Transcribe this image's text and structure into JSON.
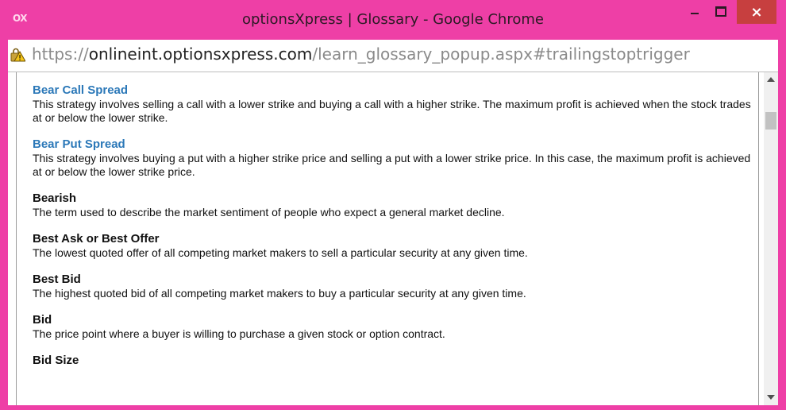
{
  "window": {
    "app_icon_text": "OX",
    "title": "optionsXpress | Glossary - Google Chrome",
    "close_glyph": "×"
  },
  "address": {
    "scheme": "https://",
    "host": "onlineint.optionsxpress.com",
    "path": "/learn_glossary_popup.aspx#trailingstoptrigger",
    "lock_icon": "warning-lock-icon"
  },
  "colors": {
    "frame": "#ee3fa6",
    "link_term": "#2b78b8",
    "close_button": "#c73f3f"
  },
  "glossary": [
    {
      "term": "Bear Call Spread",
      "style": "link",
      "definition": "This strategy involves selling a call with a lower strike and buying a call with a higher strike. The maximum profit is achieved when the stock trades at or below the lower strike."
    },
    {
      "term": "Bear Put Spread",
      "style": "link",
      "definition": "This strategy involves buying a put with a higher strike price and selling a put with a lower strike price. In this case, the maximum profit is achieved at or below the lower strike price."
    },
    {
      "term": "Bearish",
      "style": "plain",
      "definition": "The term used to describe the market sentiment of people who expect a general market decline."
    },
    {
      "term": "Best Ask or Best Offer",
      "style": "plain",
      "definition": "The lowest quoted offer of all competing market makers to sell a particular security at any given time."
    },
    {
      "term": "Best Bid",
      "style": "plain",
      "definition": "The highest quoted bid of all competing market makers to buy a particular security at any given time."
    },
    {
      "term": "Bid",
      "style": "plain",
      "definition": "The price point where a buyer is willing to purchase a given stock or option contract."
    },
    {
      "term": "Bid Size",
      "style": "plain",
      "definition": ""
    }
  ]
}
